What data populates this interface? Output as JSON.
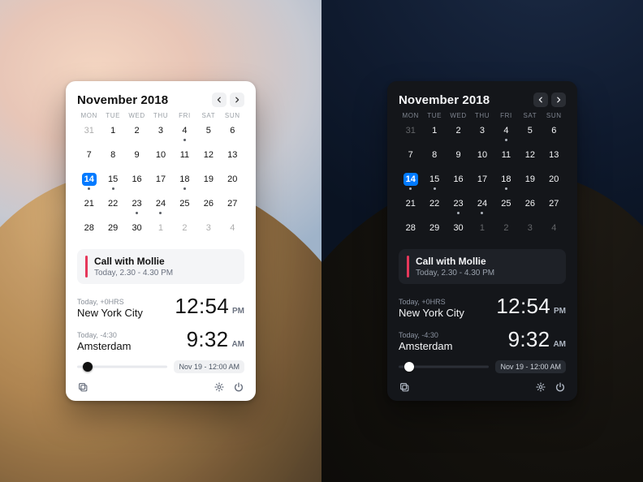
{
  "header": {
    "title": "November 2018",
    "weekdays": [
      "MON",
      "TUE",
      "WED",
      "THU",
      "FRI",
      "SAT",
      "SUN"
    ]
  },
  "calendar": {
    "days": [
      {
        "n": "31",
        "muted": true
      },
      {
        "n": "1"
      },
      {
        "n": "2"
      },
      {
        "n": "3"
      },
      {
        "n": "4",
        "has": true
      },
      {
        "n": "5"
      },
      {
        "n": "6"
      },
      {
        "n": "7"
      },
      {
        "n": "8"
      },
      {
        "n": "9"
      },
      {
        "n": "10"
      },
      {
        "n": "11"
      },
      {
        "n": "12"
      },
      {
        "n": "13"
      },
      {
        "n": "14",
        "sel": true,
        "has": true
      },
      {
        "n": "15",
        "has": true
      },
      {
        "n": "16"
      },
      {
        "n": "17"
      },
      {
        "n": "18",
        "has": true
      },
      {
        "n": "19"
      },
      {
        "n": "20"
      },
      {
        "n": "21"
      },
      {
        "n": "22"
      },
      {
        "n": "23",
        "has": true
      },
      {
        "n": "24",
        "has": true
      },
      {
        "n": "25"
      },
      {
        "n": "26"
      },
      {
        "n": "27"
      },
      {
        "n": "28"
      },
      {
        "n": "29"
      },
      {
        "n": "30"
      },
      {
        "n": "1",
        "muted": true
      },
      {
        "n": "2",
        "muted": true
      },
      {
        "n": "3",
        "muted": true
      },
      {
        "n": "4",
        "muted": true
      }
    ]
  },
  "event": {
    "title": "Call with Mollie",
    "subtitle": "Today, 2.30 - 4.30 PM"
  },
  "clocks": [
    {
      "meta": "Today, +0HRS",
      "city": "New York City",
      "time": "12:54",
      "ampm": "PM"
    },
    {
      "meta": "Today, -4:30",
      "city": "Amsterdam",
      "time": "9:32",
      "ampm": "AM"
    }
  ],
  "slider": {
    "pos": 12,
    "label": "Nov 19 - 12:00 AM"
  },
  "colors": {
    "accent": "#007aff",
    "event": "#e6375a"
  }
}
